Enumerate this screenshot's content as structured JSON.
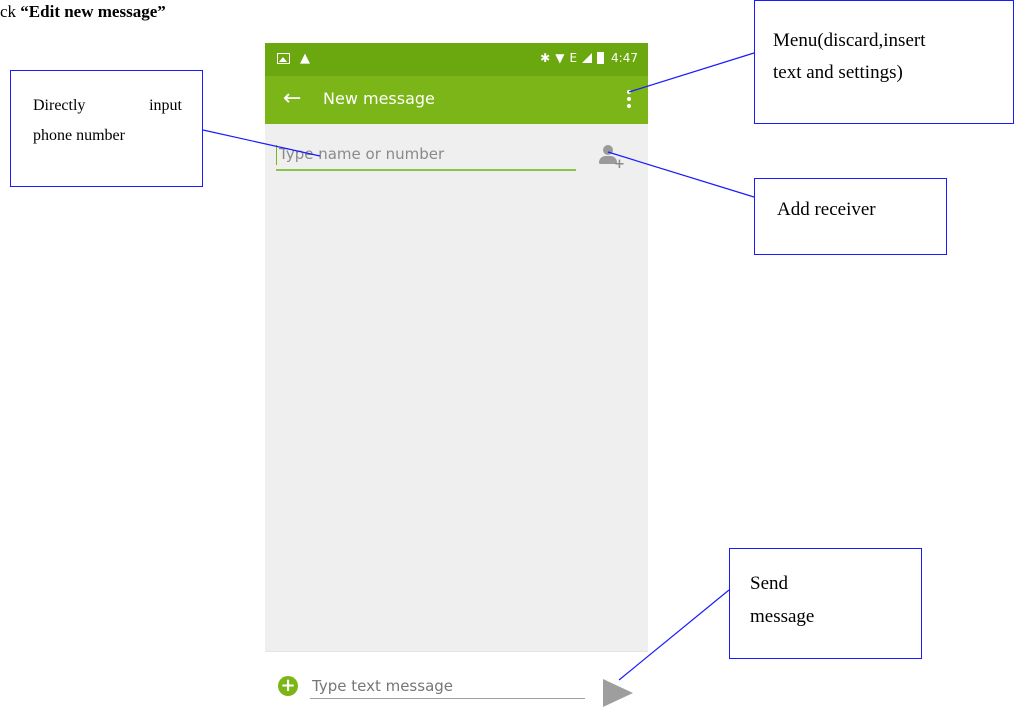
{
  "document": {
    "heading_prefix": "ck ",
    "heading_bold": "“Edit new message”"
  },
  "status_bar": {
    "time": "4:47",
    "network_type": "E",
    "icons": [
      "image-icon",
      "warning-icon",
      "bluetooth-icon",
      "wifi-icon",
      "signal-icon",
      "battery-icon"
    ]
  },
  "app_bar": {
    "title": "New message",
    "back_icon": "arrow-back-icon",
    "menu_icon": "more-vert-icon"
  },
  "recipient": {
    "placeholder": "Type name or number",
    "add_icon": "add-person-icon"
  },
  "compose": {
    "placeholder": "Type text message",
    "attach_icon": "add-circle-icon",
    "send_icon": "send-icon"
  },
  "callouts": {
    "input": {
      "line1": "Directly input",
      "line2": "phone number"
    },
    "menu": {
      "line1": "Menu(discard,insert",
      "line2": "text and settings)"
    },
    "receiver": {
      "text": "Add receiver"
    },
    "send": {
      "line1": "Send",
      "line2": "message"
    }
  },
  "colors": {
    "status_bar": "#6ba810",
    "app_bar": "#7cb518",
    "callout_border": "#1a1aff",
    "screen_background": "#efefef"
  }
}
